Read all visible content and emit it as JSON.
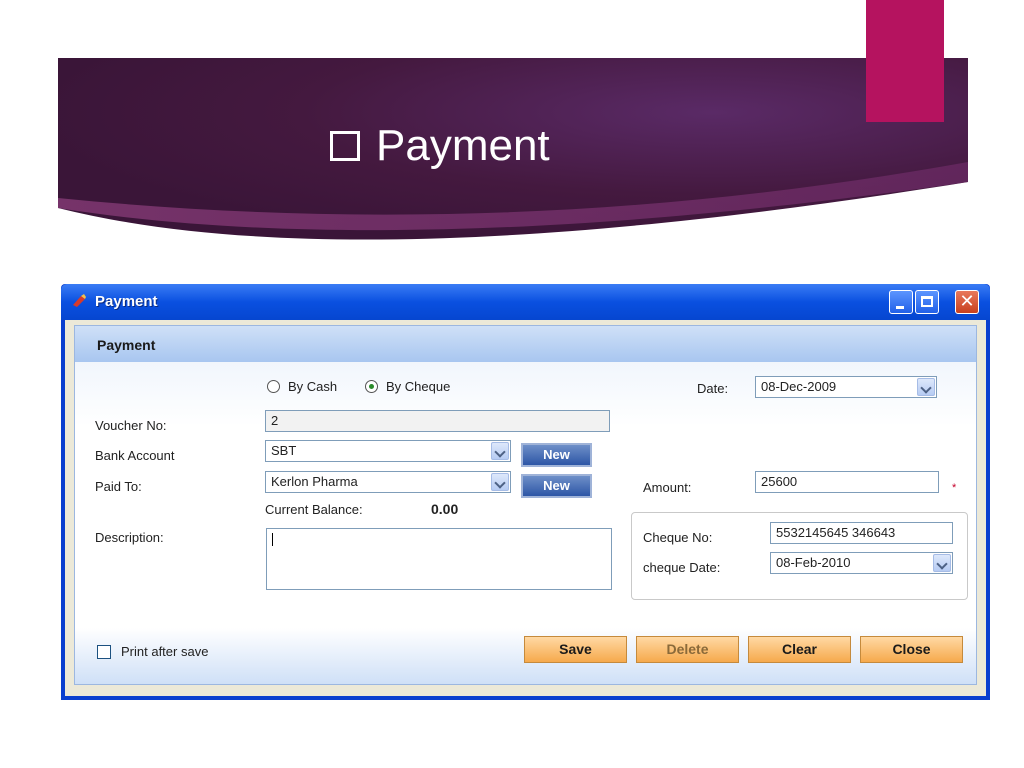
{
  "slide": {
    "title": "Payment"
  },
  "window": {
    "title": "Payment",
    "close_glyph": "✕",
    "panel_title": "Payment",
    "payment_mode": {
      "by_cash_label": "By Cash",
      "by_cheque_label": "By Cheque",
      "selected": "By Cheque"
    },
    "date": {
      "label": "Date:",
      "value": "08-Dec-2009"
    },
    "voucher_no": {
      "label": "Voucher No:",
      "value": "2"
    },
    "bank_account": {
      "label": "Bank Account",
      "value": "SBT",
      "new_label": "New"
    },
    "paid_to": {
      "label": "Paid To:",
      "value": "Kerlon Pharma",
      "new_label": "New"
    },
    "current_balance": {
      "label": "Current Balance:",
      "value": "0.00"
    },
    "amount": {
      "label": "Amount:",
      "value": "25600",
      "required_mark": "*"
    },
    "description": {
      "label": "Description:",
      "value": ""
    },
    "cheque_no": {
      "label": "Cheque No:",
      "value": "5532145645 346643"
    },
    "cheque_date": {
      "label": "cheque Date:",
      "value": "08-Feb-2010"
    },
    "print_after_save": {
      "label": "Print after save",
      "checked": false
    },
    "buttons": {
      "save": "Save",
      "delete": "Delete",
      "clear": "Clear",
      "close": "Close"
    }
  },
  "colors": {
    "band": "#4a1e4f",
    "accent": "#b5135f",
    "titlebar": "#0a50e0",
    "action_button": "#f6a94c"
  }
}
